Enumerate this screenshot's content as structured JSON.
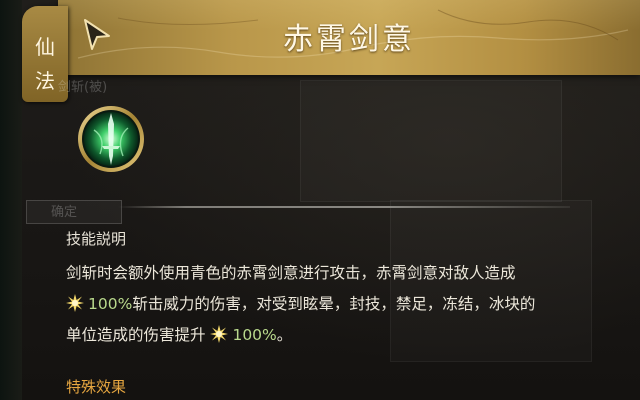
{
  "side_tab": {
    "label_1": "仙",
    "label_2": "法"
  },
  "header": {
    "title": "赤霄剑意"
  },
  "background": {
    "faint_label": "剑斩(被)",
    "faint_button_label": "确定"
  },
  "skill": {
    "icon_name": "green-sword-emblem-icon"
  },
  "description": {
    "heading": "技能説明",
    "line1": "剑斩时会额外使用青色的赤霄剑意进行攻击，赤霄剑意对敌人造成",
    "line2_value": "100%",
    "line2_rest": "斩击威力的伤害，对受到眩晕，封技，禁足，冻结，冰块的",
    "line3_prefix": "单位造成的伤害提升",
    "line3_value": "100%",
    "line3_suffix": "。"
  },
  "special": {
    "heading": "特殊效果"
  },
  "colors": {
    "header_gold": "#b9974a",
    "value_green": "#b9d98c",
    "special_orange": "#e6a640",
    "text_light": "#ece7da"
  }
}
